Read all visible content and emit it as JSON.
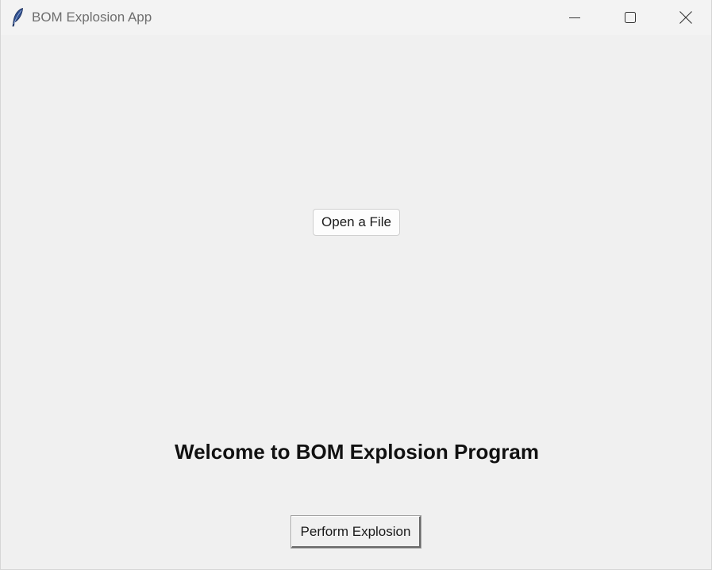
{
  "window": {
    "title": "BOM Explosion App",
    "icon": "feather-icon",
    "controls": {
      "minimize": "minimize-icon",
      "maximize": "maximize-icon",
      "close": "close-icon"
    }
  },
  "main": {
    "open_file_label": "Open a File",
    "welcome_text": "Welcome to BOM Explosion Program",
    "perform_explosion_label": "Perform Explosion"
  },
  "colors": {
    "background": "#f0f0f0",
    "titlebar": "#f3f3f3",
    "title_text": "#6e6e6e",
    "feather_icon": "#3a5fa0"
  }
}
